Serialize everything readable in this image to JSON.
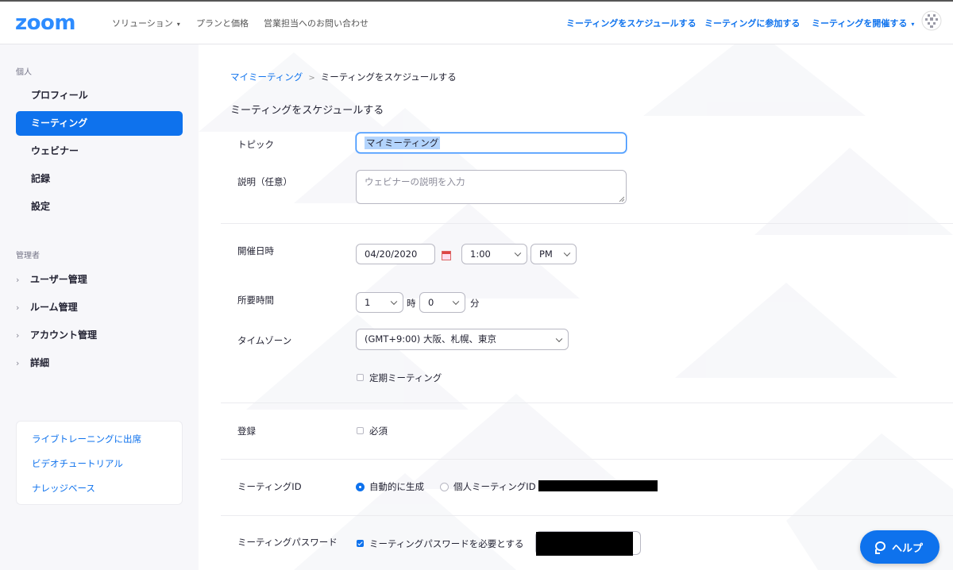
{
  "header": {
    "logo": "zoom",
    "nav_left": [
      {
        "label": "ソリューション",
        "dropdown": true
      },
      {
        "label": "プランと価格",
        "dropdown": false
      },
      {
        "label": "営業担当へのお問い合わせ",
        "dropdown": false
      }
    ],
    "nav_right": [
      {
        "label": "ミーティングをスケジュールする",
        "dropdown": false
      },
      {
        "label": "ミーティングに参加する",
        "dropdown": false
      },
      {
        "label": "ミーティングを開催する",
        "dropdown": true
      }
    ],
    "caret_icon": "▾"
  },
  "sidebar": {
    "personal_label": "個人",
    "personal_items": [
      {
        "label": "プロフィール",
        "active": false
      },
      {
        "label": "ミーティング",
        "active": true
      },
      {
        "label": "ウェビナー",
        "active": false
      },
      {
        "label": "記録",
        "active": false
      },
      {
        "label": "設定",
        "active": false
      }
    ],
    "admin_label": "管理者",
    "admin_items": [
      {
        "label": "ユーザー管理"
      },
      {
        "label": "ルーム管理"
      },
      {
        "label": "アカウント管理"
      },
      {
        "label": "詳細"
      }
    ],
    "chevron_icon": "›",
    "help_links": [
      {
        "label": "ライブトレーニングに出席"
      },
      {
        "label": "ビデオチュートリアル"
      },
      {
        "label": "ナレッジベース"
      }
    ]
  },
  "breadcrumb": {
    "link": "マイミーティング",
    "separator": ">",
    "current": "ミーティングをスケジュールする"
  },
  "page_title": "ミーティングをスケジュールする",
  "form": {
    "topic": {
      "label": "トピック",
      "value": "マイミーティング"
    },
    "description": {
      "label": "説明（任意）",
      "placeholder": "ウェビナーの説明を入力"
    },
    "when": {
      "label": "開催日時",
      "date": "04/20/2020",
      "time": "1:00",
      "ampm": "PM"
    },
    "duration": {
      "label": "所要時間",
      "hours": "1",
      "hours_unit": "時",
      "minutes": "0",
      "minutes_unit": "分"
    },
    "timezone": {
      "label": "タイムゾーン",
      "value": "(GMT+9:00) 大阪、札幌、東京"
    },
    "recurring": {
      "label": "定期ミーティング",
      "checked": false
    },
    "registration": {
      "label": "登録",
      "option": "必須",
      "checked": false
    },
    "meeting_id": {
      "label": "ミーティングID",
      "auto": "自動的に生成",
      "personal": "個人ミーティングID",
      "selected": "auto"
    },
    "password": {
      "label": "ミーティングパスワード",
      "option": "ミーティングパスワードを必要とする",
      "checked": true
    }
  },
  "help_button": {
    "label": "ヘルプ"
  },
  "colors": {
    "accent": "#0e72ed",
    "logo": "#2d8cff",
    "sidebar_bg": "#f7f7fa"
  }
}
